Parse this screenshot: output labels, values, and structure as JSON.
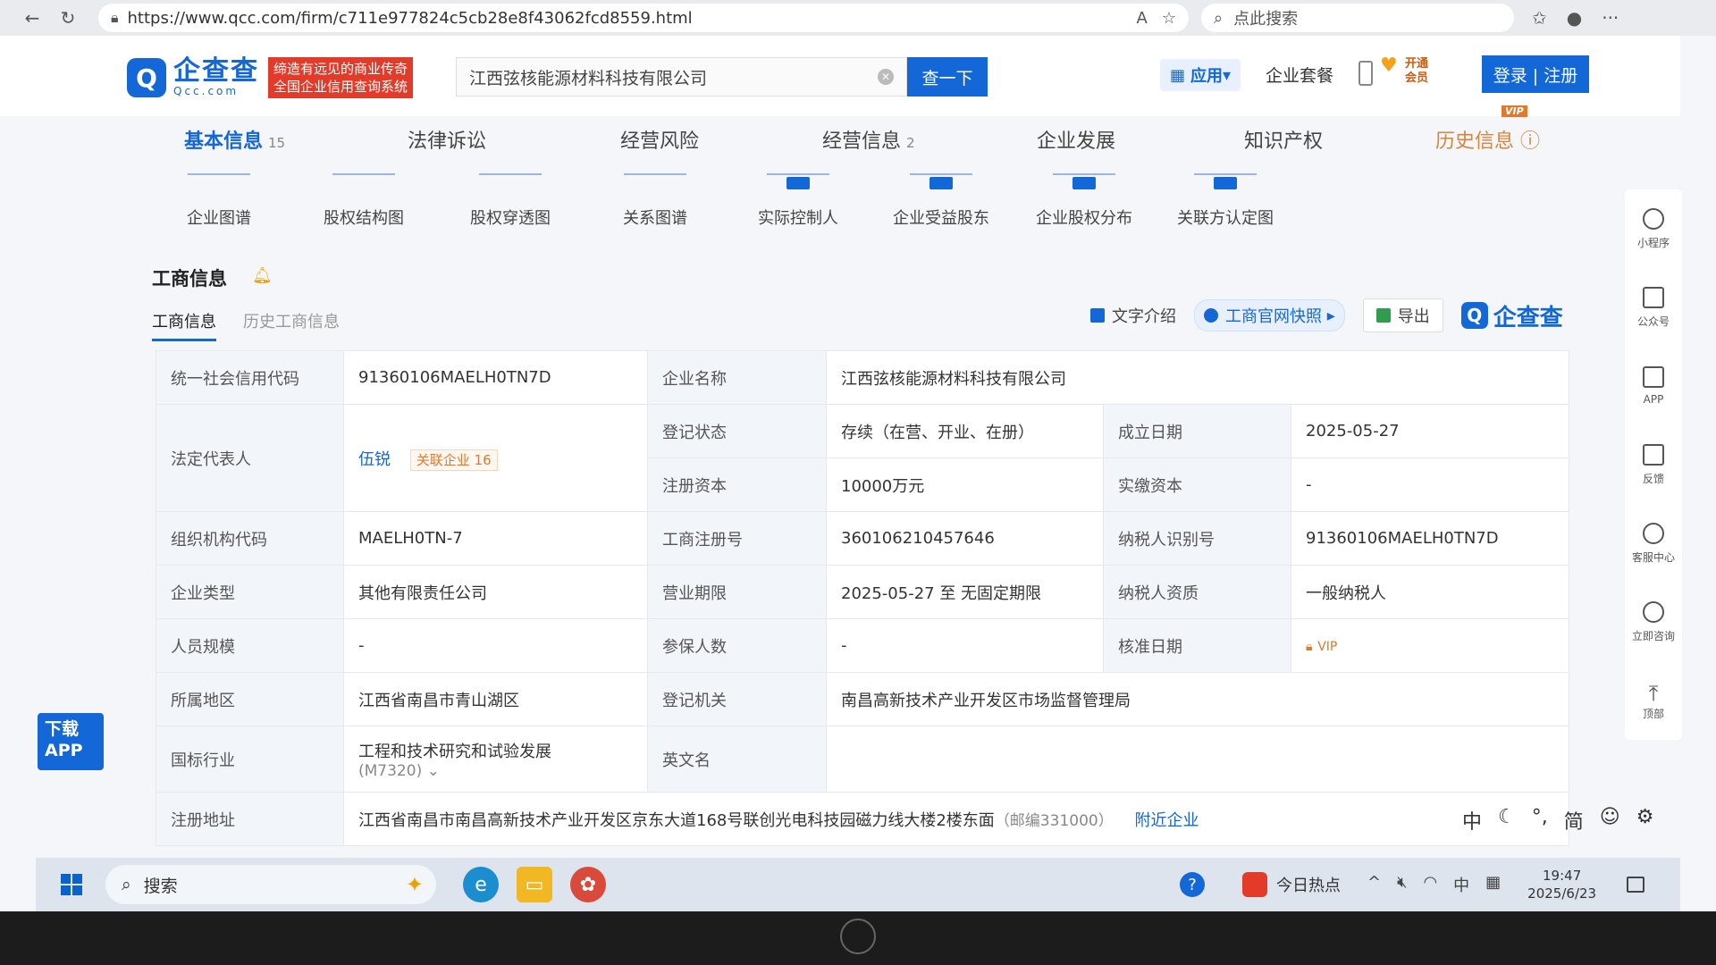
{
  "browser": {
    "url": "https://www.qcc.com/firm/c711e977824c5cb28e8f43062fcd8559.html",
    "search_placeholder": "点此搜索"
  },
  "header": {
    "logo_cn": "企查查",
    "logo_en": "Qcc.com",
    "slogan_line1": "缔造有远见的商业传奇",
    "slogan_line2": "全国企业信用查询系统",
    "search_value": "江西弦核能源材料科技有限公司",
    "search_button": "查一下",
    "app_button": "应用",
    "suite": "企业套餐",
    "vip_line1": "开通",
    "vip_line2": "会员",
    "login": "登录 | 注册"
  },
  "main_tabs": [
    {
      "label": "基本信息",
      "count": "15"
    },
    {
      "label": "法律诉讼",
      "count": ""
    },
    {
      "label": "经营风险",
      "count": ""
    },
    {
      "label": "经营信息",
      "count": "2"
    },
    {
      "label": "企业发展",
      "count": ""
    },
    {
      "label": "知识产权",
      "count": ""
    },
    {
      "label": "历史信息",
      "count": ""
    }
  ],
  "vip_badge": "VIP",
  "charts": [
    "企业图谱",
    "股权结构图",
    "股权穿透图",
    "关系图谱",
    "实际控制人",
    "企业受益股东",
    "企业股权分布",
    "关联方认定图"
  ],
  "section": {
    "title": "工商信息",
    "sub_tabs": [
      "工商信息",
      "历史工商信息"
    ],
    "tool_text": "文字介绍",
    "tool_snapshot": "工商官网快照",
    "tool_export": "导出",
    "watermark": "企查查"
  },
  "info": {
    "credit_code_label": "统一社会信用代码",
    "credit_code": "91360106MAELH0TN7D",
    "company_name_label": "企业名称",
    "company_name": "江西弦核能源材料科技有限公司",
    "legal_rep_label": "法定代表人",
    "legal_rep": "伍锐",
    "related_label": "关联企业",
    "related_count": "16",
    "status_label": "登记状态",
    "status": "存续（在营、开业、在册）",
    "founded_label": "成立日期",
    "founded": "2025-05-27",
    "reg_capital_label": "注册资本",
    "reg_capital": "10000万元",
    "paid_capital_label": "实缴资本",
    "paid_capital": "-",
    "org_code_label": "组织机构代码",
    "org_code": "MAELH0TN-7",
    "reg_no_label": "工商注册号",
    "reg_no": "360106210457646",
    "taxpayer_id_label": "纳税人识别号",
    "taxpayer_id": "91360106MAELH0TN7D",
    "company_type_label": "企业类型",
    "company_type": "其他有限责任公司",
    "term_label": "营业期限",
    "term": "2025-05-27 至 无固定期限",
    "taxpayer_qual_label": "纳税人资质",
    "taxpayer_qual": "一般纳税人",
    "staff_label": "人员规模",
    "staff": "-",
    "insured_label": "参保人数",
    "insured": "-",
    "approval_label": "核准日期",
    "approval": "VIP",
    "region_label": "所属地区",
    "region": "江西省南昌市青山湖区",
    "authority_label": "登记机关",
    "authority": "南昌高新技术产业开发区市场监督管理局",
    "industry_label": "国标行业",
    "industry": "工程和技术研究和试验发展",
    "industry_code": "(M7320)",
    "english_label": "英文名",
    "english": "",
    "address_label": "注册地址",
    "address": "江西省南昌市南昌高新技术产业开发区京东大道168号联创光电科技园磁力线大楼2楼东面",
    "postcode": "（邮编331000）",
    "nearby": "附近企业"
  },
  "download_app_line1": "下载",
  "download_app_line2": "APP",
  "right_bar": [
    "小程序",
    "公众号",
    "APP",
    "反馈",
    "客服中心",
    "立即咨询",
    "顶部"
  ],
  "ime": [
    "中",
    "简"
  ],
  "taskbar": {
    "search": "搜索",
    "hot": "今日热点",
    "tray_ime": "中",
    "time": "19:47",
    "date": "2025/6/23"
  }
}
